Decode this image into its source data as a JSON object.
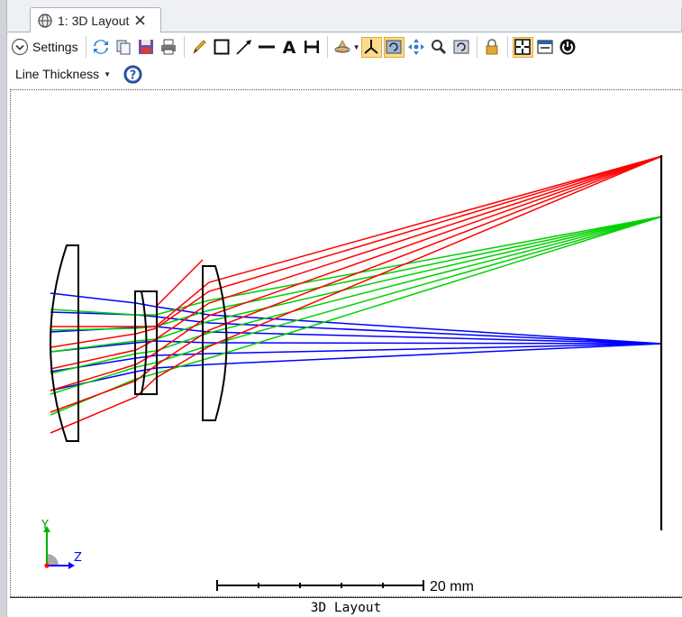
{
  "tab": {
    "label": "1: 3D Layout"
  },
  "toolbar": {
    "settings_label": "Settings",
    "icons": [
      "refresh-icon",
      "copy-icon",
      "save-icon",
      "print-icon",
      "pencil-icon",
      "rectangle-icon",
      "arrow-icon",
      "line-icon",
      "text-icon",
      "dimension-icon",
      "rotate-view-icon",
      "axes-icon",
      "reset-view-icon",
      "pan-icon",
      "zoom-icon",
      "undo-zoom-icon",
      "lock-icon",
      "fit-icon",
      "window-icon",
      "power-icon"
    ]
  },
  "toolbar2": {
    "line_thickness_label": "Line Thickness"
  },
  "plot": {
    "scale_label": "20 mm",
    "axis_labels": {
      "y": "Y",
      "z": "Z"
    },
    "footer_title": "3D Layout"
  },
  "colors": {
    "field1": "#0000ff",
    "field2": "#00d000",
    "field3": "#ff0000",
    "accent": "#fbdc8c"
  }
}
